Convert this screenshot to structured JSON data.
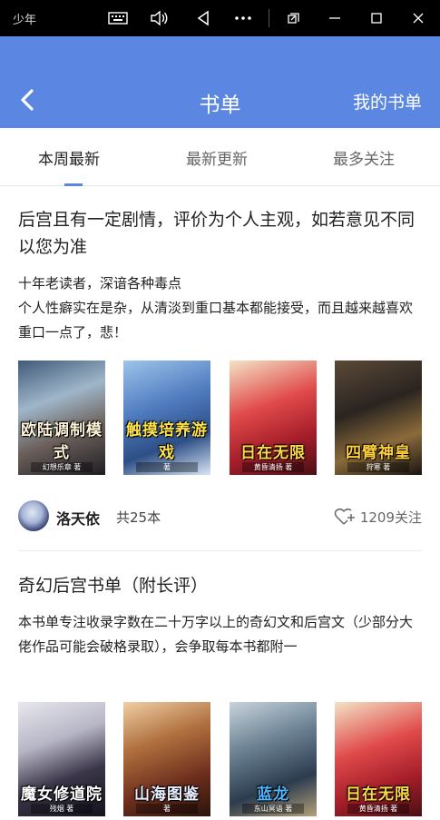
{
  "window": {
    "app_label": "少年",
    "controls": [
      "keyboard-icon",
      "volume-icon",
      "back-triangle-icon",
      "more-icon",
      "restore-icon",
      "minimize-icon",
      "maximize-icon",
      "close-icon"
    ]
  },
  "header": {
    "title": "书单",
    "my_lists": "我的书单",
    "color": "#5b87e2"
  },
  "tabs": [
    {
      "label": "本周最新",
      "active": true
    },
    {
      "label": "最新更新",
      "active": false
    },
    {
      "label": "最多关注",
      "active": false
    }
  ],
  "lists": [
    {
      "title": "后宫且有一定剧情，评价为个人主观，如若意见不同以您为准",
      "description": [
        "十年老读者，深谙各种毒点",
        "个人性癖实在是杂，从清淡到重口基本都能接受，而且越来越喜欢重口一点了，悲！"
      ],
      "books": [
        {
          "cover_title": "欧陆调制模式",
          "author": "幻想乐章 著"
        },
        {
          "cover_title": "触摸培养游戏",
          "author": "著"
        },
        {
          "cover_title": "日在无限",
          "author": "黄昏清扬 著"
        },
        {
          "cover_title": "四臂神皇",
          "author": "狩寒 著"
        }
      ],
      "author": "洛天依",
      "count": "共25本",
      "follows": "1209关注"
    },
    {
      "title": "奇幻后宫书单（附长评）",
      "description": [
        "本书单专注收录字数在二十万字以上的奇幻文和后宫文（少部分大佬作品可能会破格录取），会争取每本书都附一"
      ],
      "books": [
        {
          "cover_title": "魔女修道院",
          "author": "残烟 著"
        },
        {
          "cover_title": "山海图鉴",
          "author": "著"
        },
        {
          "cover_title": "蓝龙",
          "author": "东山冥语 著"
        },
        {
          "cover_title": "日在无限",
          "author": "黄昏清扬 著"
        }
      ]
    }
  ]
}
